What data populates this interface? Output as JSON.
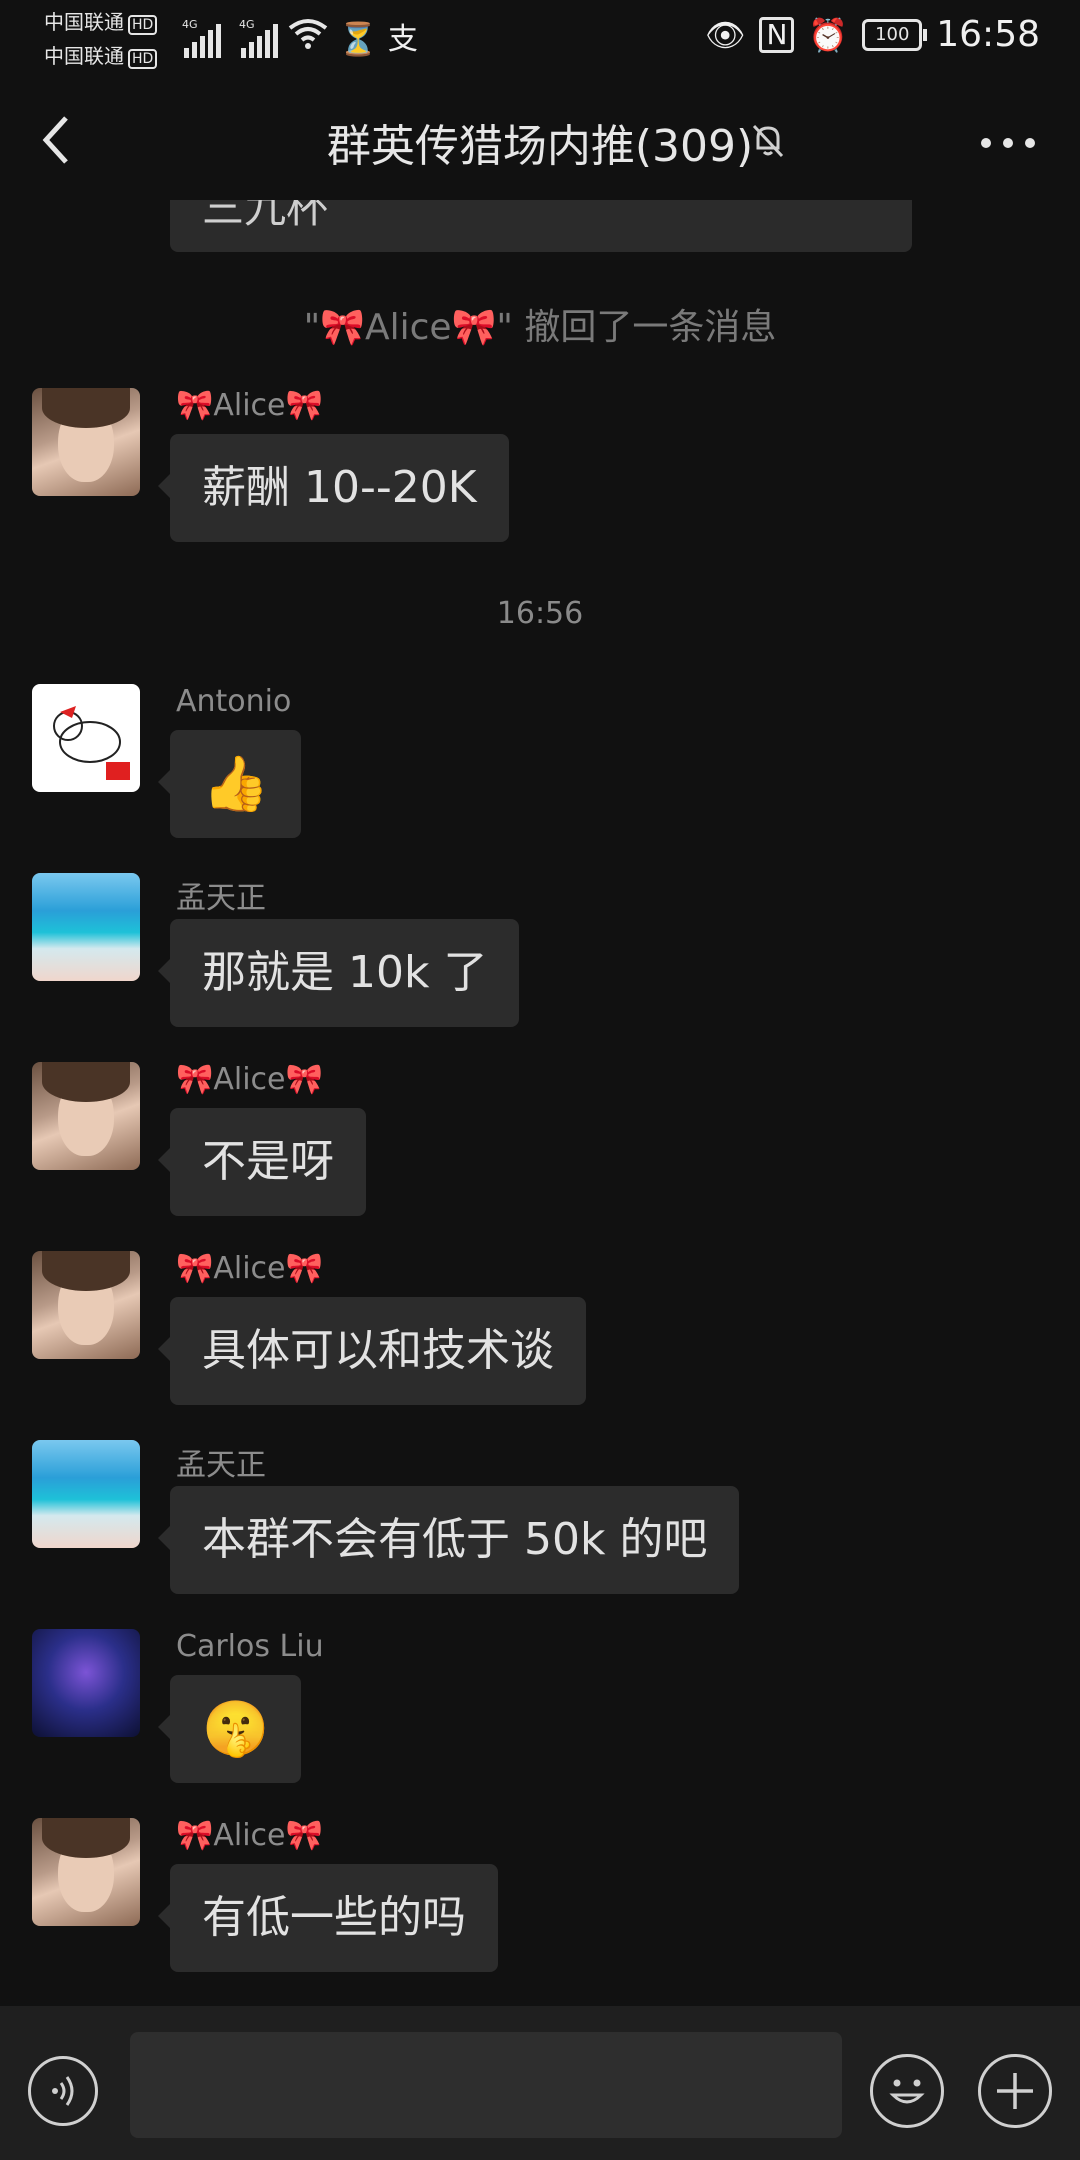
{
  "status_bar": {
    "carrier_1": "中国联通",
    "carrier_2": "中国联通",
    "hd_badge": "HD",
    "network_1": "4G",
    "network_2": "4G",
    "battery": "100",
    "time": "16:58"
  },
  "header": {
    "title": "群英传猎场内推(309)"
  },
  "messages": {
    "partial_text": "三九杯",
    "recall_notice": "\"🎀Alice🎀\" 撤回了一条消息",
    "time_separator": "16:56",
    "items": [
      {
        "sender": "🎀Alice🎀",
        "text": "薪酬 10--20K",
        "avatar": "alice"
      },
      {
        "sender": "Antonio",
        "text": "👍",
        "avatar": "antonio"
      },
      {
        "sender": "孟天正",
        "text": "那就是 10k 了",
        "avatar": "meng"
      },
      {
        "sender": "🎀Alice🎀",
        "text": "不是呀",
        "avatar": "alice"
      },
      {
        "sender": "🎀Alice🎀",
        "text": "具体可以和技术谈",
        "avatar": "alice"
      },
      {
        "sender": "孟天正",
        "text": "本群不会有低于 50k 的吧",
        "avatar": "meng"
      },
      {
        "sender": "Carlos Liu",
        "text": "🤫",
        "avatar": "carlos"
      },
      {
        "sender": "🎀Alice🎀",
        "text": "有低一些的吗",
        "avatar": "alice"
      }
    ]
  },
  "input_bar": {
    "value": "",
    "icons": [
      "voice-icon",
      "emoji-icon",
      "plus-icon"
    ]
  },
  "colors": {
    "background": "#111111",
    "bubble": "#2c2c2c",
    "input_bar": "#1f1f1f"
  }
}
